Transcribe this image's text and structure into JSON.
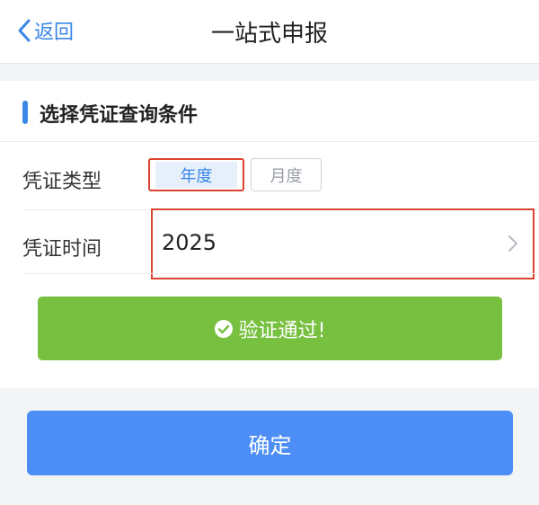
{
  "nav": {
    "back_label": "返回",
    "title": "一站式申报"
  },
  "section": {
    "title": "选择凭证查询条件"
  },
  "voucher_type": {
    "label": "凭证类型",
    "options": [
      "年度",
      "月度"
    ],
    "selected": "年度"
  },
  "voucher_time": {
    "label": "凭证时间",
    "value": "2025"
  },
  "verify": {
    "message": "验证通过!"
  },
  "confirm_label": "确定",
  "icons": {
    "back": "chevron-left-icon",
    "picker_arrow": "chevron-right-icon",
    "verify": "check-circle-icon"
  },
  "colors": {
    "accent": "#3a87e8",
    "success": "#78c140",
    "primary_button": "#4c8ef5",
    "highlight_border": "#d9442e"
  }
}
